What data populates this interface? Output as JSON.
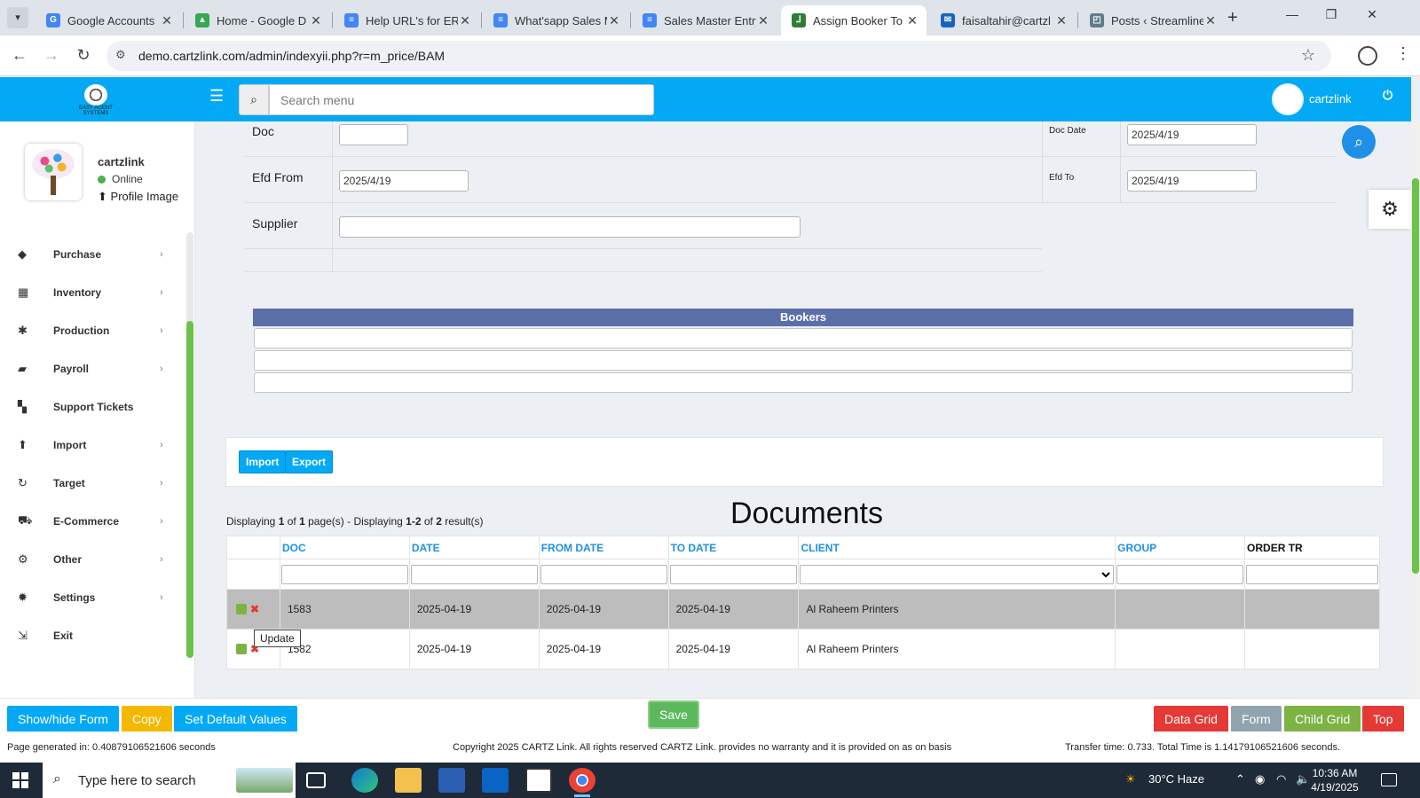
{
  "browser": {
    "tabs": [
      {
        "title": "Google Accounts",
        "fav": "G",
        "color": "#4285f4",
        "active": false
      },
      {
        "title": "Home - Google D",
        "fav": "▲",
        "color": "#34a853",
        "active": false
      },
      {
        "title": "Help URL's for ERF",
        "fav": "≡",
        "color": "#4285f4",
        "active": false
      },
      {
        "title": "What'sapp Sales M",
        "fav": "≡",
        "color": "#4285f4",
        "active": false
      },
      {
        "title": "Sales Master Entry",
        "fav": "≡",
        "color": "#4285f4",
        "active": false
      },
      {
        "title": "Assign Booker To",
        "fav": "⅃",
        "color": "#2e7d32",
        "active": true
      },
      {
        "title": "faisaltahir@cartzl",
        "fav": "✉",
        "color": "#1565c0",
        "active": false
      },
      {
        "title": "Posts ‹ Streamline",
        "fav": "◰",
        "color": "#607d8b",
        "active": false
      }
    ],
    "url": "demo.cartzlink.com/admin/indexyii.php?r=m_price/BAM"
  },
  "header": {
    "search_placeholder": "Search menu",
    "username": "cartzlink",
    "logo_text": "EASY AGENT SYSTEMS"
  },
  "sidebar": {
    "name": "cartzlink",
    "status": "Online",
    "profile_image_label": "Profile Image",
    "items": [
      {
        "label": "Purchase",
        "icon": "tags-icon",
        "glyph": "◆",
        "has_children": true
      },
      {
        "label": "Inventory",
        "icon": "grid-icon",
        "glyph": "▦",
        "has_children": true
      },
      {
        "label": "Production",
        "icon": "cogs-icon",
        "glyph": "✱",
        "has_children": true
      },
      {
        "label": "Payroll",
        "icon": "money-icon",
        "glyph": "▰",
        "has_children": true
      },
      {
        "label": "Support Tickets",
        "icon": "tickets-icon",
        "glyph": "▚",
        "has_children": false
      },
      {
        "label": "Import",
        "icon": "import-icon",
        "glyph": "⬆",
        "has_children": true
      },
      {
        "label": "Target",
        "icon": "refresh-icon",
        "glyph": "↻",
        "has_children": true
      },
      {
        "label": "E-Commerce",
        "icon": "cart-icon",
        "glyph": "⛟",
        "has_children": true
      },
      {
        "label": "Other",
        "icon": "settings-icon",
        "glyph": "⚙",
        "has_children": true
      },
      {
        "label": "Settings",
        "icon": "gear-icon",
        "glyph": "✹",
        "has_children": true
      },
      {
        "label": "Exit",
        "icon": "exit-icon",
        "glyph": "⇲",
        "has_children": false
      }
    ]
  },
  "form": {
    "doc_label": "Doc",
    "doc_value": "",
    "doc_date_label": "Doc Date",
    "doc_date_value": "2025/4/19",
    "efd_from_label": "Efd From",
    "efd_from_value": "2025/4/19",
    "efd_to_label": "Efd To",
    "efd_to_value": "2025/4/19",
    "supplier_label": "Supplier",
    "supplier_value": ""
  },
  "bookers": {
    "title": "Bookers",
    "rows": [
      "",
      "",
      ""
    ]
  },
  "actions": {
    "import": "Import",
    "export": "Export"
  },
  "documents": {
    "title": "Documents",
    "summary": {
      "pages_prefix": "Displaying ",
      "page": "1",
      "of": " of ",
      "total_pages": "1",
      "pages_suffix": " page(s)  -  Displaying ",
      "range": "1-2",
      "of2": " of ",
      "total": "2",
      "result_suffix": " result(s)"
    },
    "columns": [
      "DOC",
      "DATE",
      "FROM DATE",
      "TO DATE",
      "CLIENT",
      "GROUP",
      "ORDER TR"
    ],
    "rows": [
      {
        "doc": "1583",
        "date": "2025-04-19",
        "from": "2025-04-19",
        "to": "2025-04-19",
        "client": "Al Raheem Printers",
        "group": "",
        "order": ""
      },
      {
        "doc": "1582",
        "date": "2025-04-19",
        "from": "2025-04-19",
        "to": "2025-04-19",
        "client": "Al Raheem Printers",
        "group": "",
        "order": ""
      }
    ],
    "tooltip": "Update"
  },
  "toolbar": {
    "show_hide": "Show/hide Form",
    "copy": "Copy",
    "set_default": "Set Default Values",
    "save": "Save",
    "data_grid": "Data Grid",
    "form": "Form",
    "child_grid": "Child Grid",
    "top": "Top"
  },
  "footer": {
    "generated": "Page generated in: 0.40879106521606 seconds",
    "copyright": "Copyright 2025 CARTZ Link. All rights reserved CARTZ Link. provides no warranty and it is provided on as on basis",
    "transfer": "Transfer time: 0.733. Total Time is 1.14179106521606 seconds."
  },
  "taskbar": {
    "search_placeholder": "Type here to search",
    "weather": "30°C  Haze",
    "time": "10:36 AM",
    "date": "4/19/2025"
  },
  "colors": {
    "accent": "#03a9f4",
    "save": "#5cb85c",
    "copy": "#f5b800",
    "danger": "#e53935",
    "gray": "#90a4ae",
    "green": "#7cb342"
  }
}
